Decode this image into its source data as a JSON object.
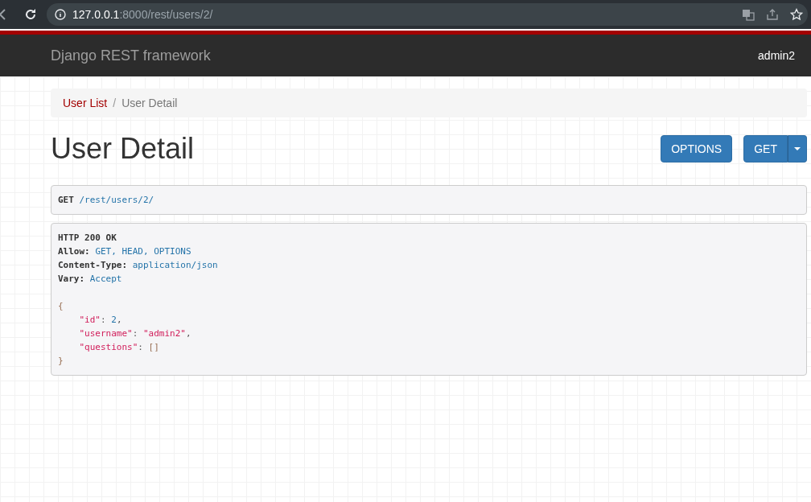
{
  "browser": {
    "url_host": "127.0.0.1",
    "url_rest": ":8000/rest/users/2/"
  },
  "navbar": {
    "brand": "Django REST framework",
    "user": "admin2"
  },
  "breadcrumb_separator": "/",
  "breadcrumb": [
    {
      "label": "User List",
      "current": false
    },
    {
      "label": "User Detail",
      "current": true
    }
  ],
  "title": "User Detail",
  "buttons": [
    {
      "label": "OPTIONS",
      "dropdown": false
    },
    {
      "label": "GET",
      "dropdown": true
    }
  ],
  "request": {
    "method": "GET",
    "path": "/rest/users/2/"
  },
  "response": {
    "status": "HTTP 200 OK",
    "headers": [
      {
        "name": "Allow:",
        "value": "GET, HEAD, OPTIONS"
      },
      {
        "name": "Content-Type:",
        "value": "application/json"
      },
      {
        "name": "Vary:",
        "value": "Accept"
      }
    ],
    "open": "{",
    "members": [
      {
        "key": "\"id\"",
        "colon": ":",
        "value": "2",
        "kind": "number",
        "comma": ","
      },
      {
        "key": "\"username\"",
        "colon": ":",
        "value": "\"admin2\"",
        "kind": "string",
        "comma": ","
      },
      {
        "key": "\"questions\"",
        "colon": ":",
        "value": "[]",
        "kind": "punct"
      }
    ],
    "close": "}"
  }
}
